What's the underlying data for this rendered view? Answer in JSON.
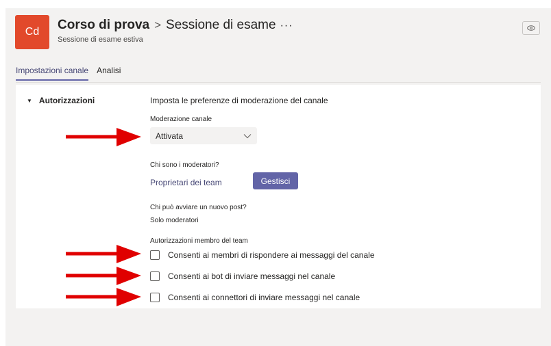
{
  "header": {
    "avatar_initials": "Cd",
    "avatar_color": "#e2492b",
    "team_name": "Corso di prova",
    "separator": ">",
    "channel_name": "Sessione di esame",
    "more_label": "···",
    "subtitle": "Sessione di esame estiva",
    "view_icon": "eye-icon"
  },
  "tabs": [
    {
      "label": "Impostazioni canale",
      "active": true
    },
    {
      "label": "Analisi",
      "active": false
    }
  ],
  "settings": {
    "section_title": "Autorizzazioni",
    "intro": "Imposta le preferenze di moderazione del canale",
    "moderation": {
      "label": "Moderazione canale",
      "value": "Attivata"
    },
    "moderators": {
      "label": "Chi sono i moderatori?",
      "value": "Proprietari dei team",
      "button": "Gestisci"
    },
    "new_post": {
      "label": "Chi può avviare un nuovo post?",
      "value": "Solo moderatori"
    },
    "member_permissions": {
      "label": "Autorizzazioni membro del team",
      "options": [
        {
          "label": "Consenti ai membri di rispondere ai messaggi del canale",
          "checked": false
        },
        {
          "label": "Consenti ai bot di inviare messaggi nel canale",
          "checked": false
        },
        {
          "label": "Consenti ai connettori di inviare messaggi nel canale",
          "checked": false
        }
      ]
    }
  },
  "colors": {
    "accent": "#6264a7",
    "annotation_arrow": "#e00000"
  }
}
